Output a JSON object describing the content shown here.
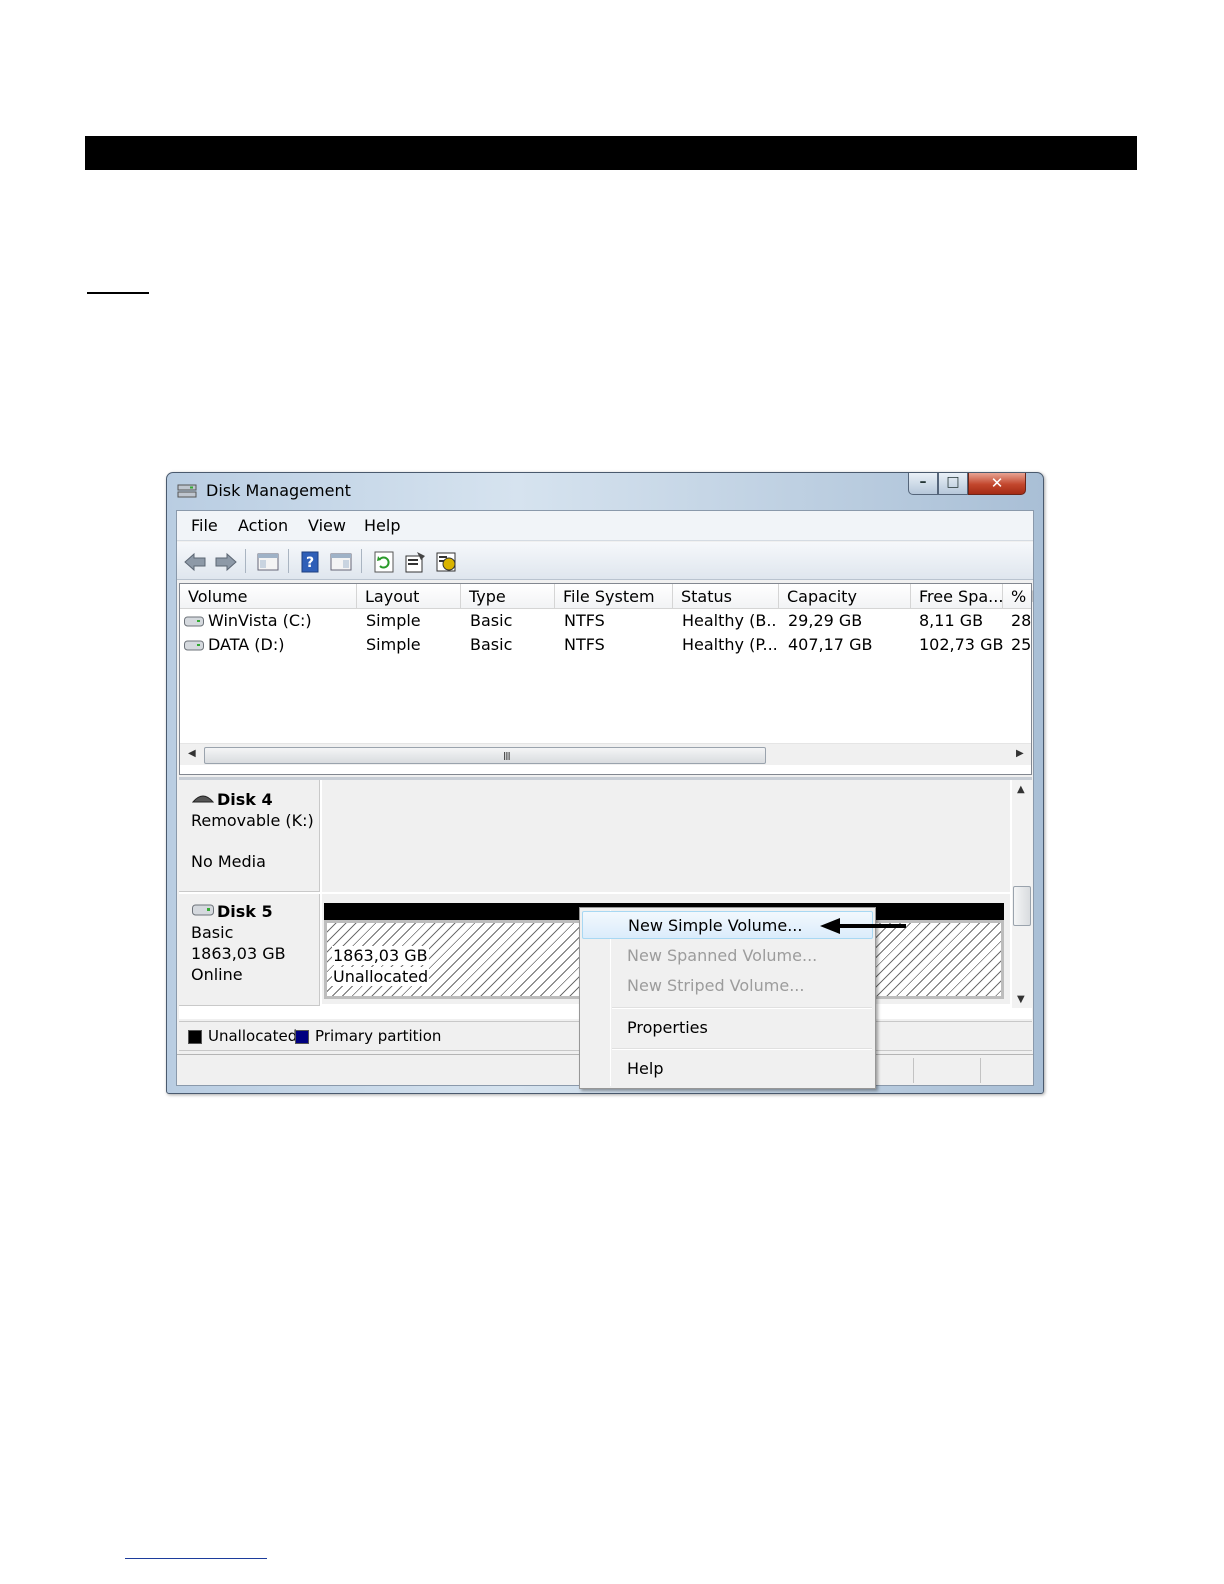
{
  "window": {
    "title": "Disk Management"
  },
  "menu": {
    "file": "File",
    "action": "Action",
    "view": "View",
    "help": "Help"
  },
  "volumes": {
    "columns": [
      "Volume",
      "Layout",
      "Type",
      "File System",
      "Status",
      "Capacity",
      "Free Spa...",
      "% F"
    ],
    "rows": [
      {
        "volume": "WinVista (C:)",
        "layout": "Simple",
        "type": "Basic",
        "fs": "NTFS",
        "status": "Healthy (B...",
        "capacity": "29,29 GB",
        "free": "8,11 GB",
        "pct": "28"
      },
      {
        "volume": "DATA (D:)",
        "layout": "Simple",
        "type": "Basic",
        "fs": "NTFS",
        "status": "Healthy (P...",
        "capacity": "407,17 GB",
        "free": "102,73 GB",
        "pct": "25"
      }
    ],
    "scroll_grip": "III"
  },
  "disks": {
    "disk4": {
      "name": "Disk 4",
      "line1": "Removable (K:)",
      "line2": "No Media"
    },
    "disk5": {
      "name": "Disk 5",
      "line1": "Basic",
      "line2": "1863,03 GB",
      "line3": "Online",
      "partition": {
        "size": "1863,03 GB",
        "status": "Unallocated"
      }
    }
  },
  "legend": {
    "unallocated": "Unallocated",
    "primary": "Primary partition",
    "unallocated_color": "#000000",
    "primary_color": "#000080"
  },
  "context_menu": {
    "new_simple": "New Simple Volume...",
    "new_spanned": "New Spanned Volume...",
    "new_striped": "New Striped Volume...",
    "properties": "Properties",
    "help": "Help"
  }
}
